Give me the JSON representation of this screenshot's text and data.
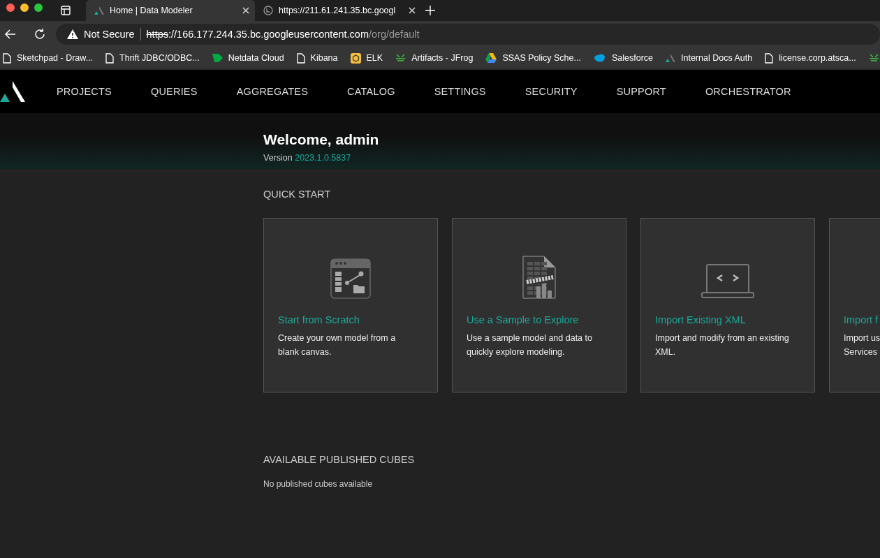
{
  "browser": {
    "tabs": [
      {
        "title": "Home | Data Modeler",
        "selected": true
      },
      {
        "title": "https://211.61.241.35.bc.googl",
        "selected": false
      }
    ],
    "address": {
      "warning": "Not Secure",
      "scheme": "https",
      "host": "://166.177.244.35.bc.googleusercontent.com",
      "path": "/org/default"
    },
    "bookmarks": [
      {
        "label": "Sketchpad - Draw..."
      },
      {
        "label": "Thrift JDBC/ODBC..."
      },
      {
        "label": "Netdata Cloud"
      },
      {
        "label": "Kibana"
      },
      {
        "label": "ELK"
      },
      {
        "label": "Artifacts - JFrog"
      },
      {
        "label": "SSAS Policy Sche..."
      },
      {
        "label": "Salesforce"
      },
      {
        "label": "Internal Docs Auth"
      },
      {
        "label": "license.corp.atsca..."
      }
    ]
  },
  "nav": {
    "items": [
      {
        "label": "PROJECTS"
      },
      {
        "label": "QUERIES"
      },
      {
        "label": "AGGREGATES"
      },
      {
        "label": "CATALOG"
      },
      {
        "label": "SETTINGS"
      },
      {
        "label": "SECURITY"
      },
      {
        "label": "SUPPORT"
      },
      {
        "label": "ORCHESTRATOR"
      }
    ]
  },
  "welcome": {
    "title": "Welcome, admin",
    "version_label": "Version",
    "version": "2023.1.0.5837"
  },
  "quick_start": {
    "heading": "QUICK START",
    "cards": [
      {
        "title": "Start from Scratch",
        "lines": [
          "Create your own model from a",
          "blank canvas."
        ]
      },
      {
        "title": "Use a Sample to Explore",
        "lines": [
          "Use a sample model and data to",
          "quickly explore modeling."
        ]
      },
      {
        "title": "Import Existing XML",
        "lines": [
          "Import and modify from an existing",
          "XML."
        ]
      },
      {
        "title": "Import f",
        "lines": [
          "Import us",
          "Services"
        ]
      }
    ]
  },
  "cubes": {
    "heading": "AVAILABLE PUBLISHED CUBES",
    "empty": "No published cubes available"
  }
}
